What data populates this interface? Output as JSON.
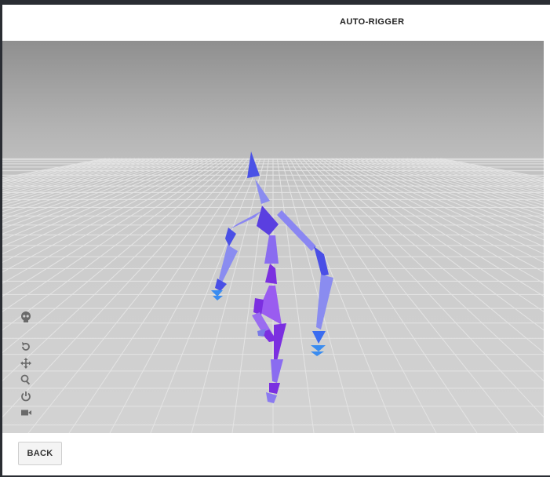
{
  "header": {
    "title": "AUTO-RIGGER"
  },
  "viewport": {
    "tools": [
      {
        "name": "skeleton-icon"
      },
      {
        "name": "rotate-icon"
      },
      {
        "name": "move-icon"
      },
      {
        "name": "zoom-icon"
      },
      {
        "name": "power-icon"
      },
      {
        "name": "camera-icon"
      }
    ]
  },
  "footer": {
    "back_label": "BACK"
  },
  "colors": {
    "bone_blue": "#4a55e6",
    "bone_light": "#8c8cf2",
    "bone_purple": "#7b2fe0",
    "bone_cyan": "#3a8cf0",
    "tool_icon": "#666666"
  }
}
